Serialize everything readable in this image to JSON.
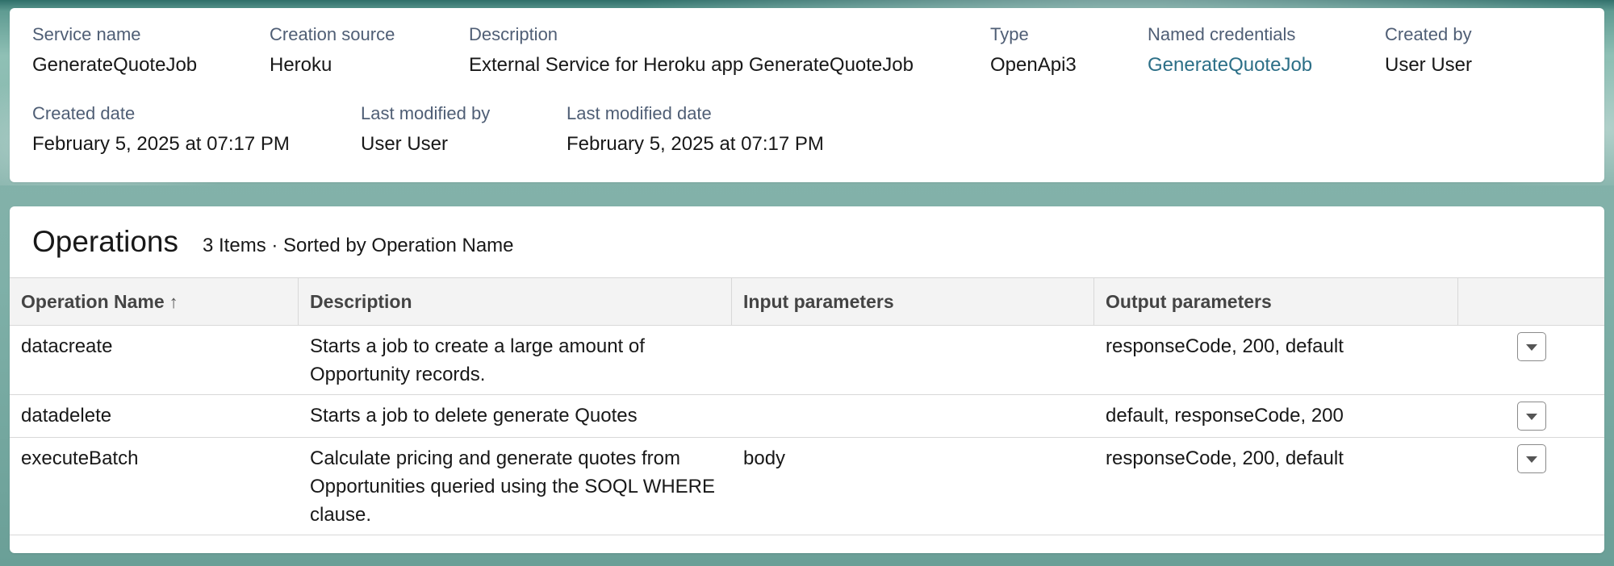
{
  "details": {
    "service_name_label": "Service name",
    "service_name_value": "GenerateQuoteJob",
    "creation_source_label": "Creation source",
    "creation_source_value": "Heroku",
    "description_label": "Description",
    "description_value": "External Service for Heroku app GenerateQuoteJob",
    "type_label": "Type",
    "type_value": "OpenApi3",
    "named_credentials_label": "Named credentials",
    "named_credentials_value": "GenerateQuoteJob",
    "created_by_label": "Created by",
    "created_by_value": "User User",
    "created_date_label": "Created date",
    "created_date_value": "February 5, 2025 at 07:17 PM",
    "last_modified_by_label": "Last modified by",
    "last_modified_by_value": "User User",
    "last_modified_date_label": "Last modified date",
    "last_modified_date_value": "February 5, 2025 at 07:17 PM"
  },
  "operations": {
    "title": "Operations",
    "meta": "3 Items · Sorted by Operation Name",
    "columns": {
      "name": "Operation Name",
      "description": "Description",
      "input": "Input parameters",
      "output": "Output parameters"
    },
    "sort_icon": "arrow-up-icon",
    "rows": [
      {
        "name": "datacreate",
        "description": "Starts a job to create a large amount of Opportunity records.",
        "input": "",
        "output": "responseCode, 200, default"
      },
      {
        "name": "datadelete",
        "description": "Starts a job to delete generate Quotes",
        "input": "",
        "output": "default, responseCode, 200"
      },
      {
        "name": "executeBatch",
        "description": "Calculate pricing and generate quotes from Opportunities queried using the SOQL WHERE clause.",
        "input": "body",
        "output": "responseCode, 200, default"
      }
    ]
  },
  "colors": {
    "link": "#2c6f87",
    "label": "#4f5e75",
    "header_bg": "#f3f3f3"
  }
}
